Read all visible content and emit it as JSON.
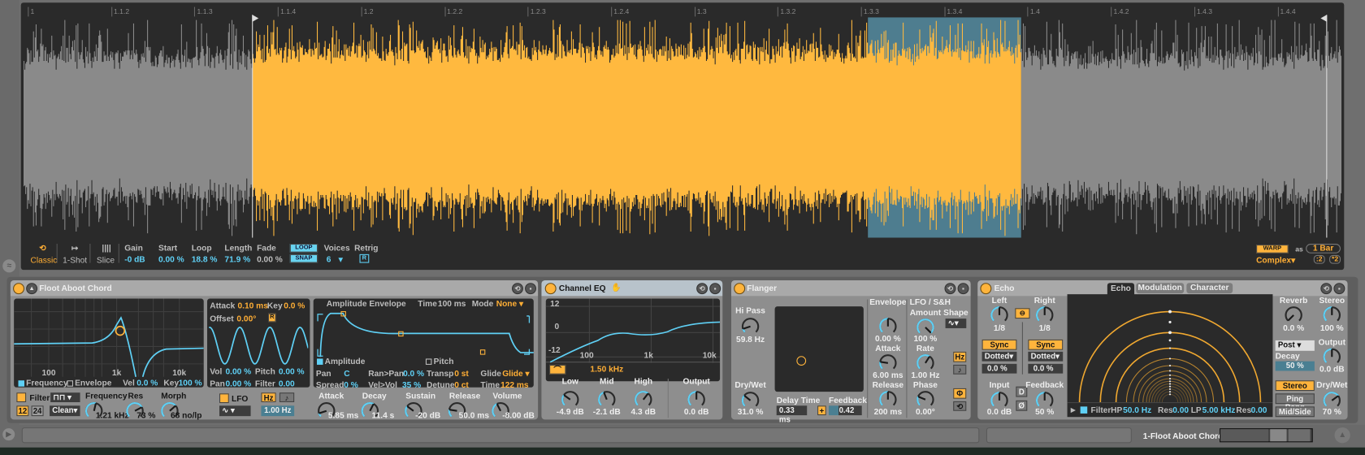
{
  "ruler": [
    "1",
    "1.1.2",
    "1.1.3",
    "1.1.4",
    "1.2",
    "1.2.2",
    "1.2.3",
    "1.2.4",
    "1.3",
    "1.3.2",
    "1.3.3",
    "1.3.4",
    "1.4",
    "1.4.2",
    "1.4.3",
    "1.4.4"
  ],
  "sample": {
    "modes": [
      {
        "label": "Classic",
        "icon": "loop-icon",
        "active": true
      },
      {
        "label": "1-Shot",
        "icon": "one-shot-icon"
      },
      {
        "label": "Slice",
        "icon": "slice-icon"
      }
    ],
    "params": [
      {
        "label": "Gain",
        "value": "-0 dB"
      },
      {
        "label": "Start",
        "value": "0.00 %"
      },
      {
        "label": "Loop",
        "value": "18.8 %"
      },
      {
        "label": "Length",
        "value": "71.9 %"
      },
      {
        "label": "Fade",
        "value": "0.00 %"
      }
    ],
    "loop_btn": "LOOP",
    "snap_btn": "SNAP",
    "voices_label": "Voices",
    "voices_value": "6",
    "retrig_label": "Retrig",
    "retrig_btn": "R",
    "warp_btn": "WARP",
    "as_label": "as",
    "warp_length": "1 Bar",
    "warp_mode": "Complex",
    "half_btn": ":2",
    "double_btn": "*2",
    "colors": {
      "waveform": "#8a8a8a",
      "selected": "#ffb93f",
      "loop_region": "#4e7d8f"
    }
  },
  "instrument": {
    "title": "Floot Aboot Chord",
    "filter_display": {
      "ticks": [
        "100",
        "1k",
        "10k"
      ],
      "frequency_tab": "Frequency",
      "envelope_tab": "Envelope",
      "vel_label": "Vel",
      "vel_value": "0.0 %",
      "key_label": "Key",
      "key_value": "100 %"
    },
    "filter": {
      "label": "Filter",
      "type": "⊓⊓",
      "slope_12": "12",
      "slope_24": "24",
      "circuit": "Clean",
      "frequency_label": "Frequency",
      "frequency_value": "1.21 kHz",
      "res_label": "Res",
      "res_value": "73 %",
      "morph_label": "Morph",
      "morph_value": "68 no/lp"
    },
    "lfo_display": {
      "attack_label": "Attack",
      "attack_value": "0.10 ms",
      "key_label": "Key",
      "key_value": "0.0 %",
      "offset_label": "Offset",
      "offset_value": "0.00°",
      "r_btn": "R",
      "vol_label": "Vol",
      "vol_value": "0.00 %",
      "pitch_label": "Pitch",
      "pitch_value": "0.00 %",
      "pan_label": "Pan",
      "pan_value": "0.00 %",
      "filter_label": "Filter",
      "filter_value": "0.00"
    },
    "lfo": {
      "label": "LFO",
      "shape": "∿",
      "hz_btn": "Hz",
      "note_btn": "♪",
      "rate_value": "1.00 Hz"
    },
    "envelope": {
      "title": "Amplitude Envelope",
      "time_label": "Time",
      "time_value": "100 ms",
      "mode_label": "Mode",
      "mode_value": "None",
      "amplitude_tab": "Amplitude",
      "pitch_tab": "Pitch",
      "pan_label": "Pan",
      "pan_value": "C",
      "ranpan_label": "Ran>Pan",
      "ranpan_value": "0.0 %",
      "transp_label": "Transp",
      "transp_value": "0 st",
      "glide_label": "Glide",
      "glide_value": "Glide",
      "spread_label": "Spread",
      "spread_value": "0 %",
      "velvol_label": "Vel>Vol",
      "velvol_value": "35 %",
      "detune_label": "Detune",
      "detune_value": "0 ct",
      "gtime_label": "Time",
      "gtime_value": "122 ms"
    },
    "amp": [
      {
        "label": "Attack",
        "value": "5.85 ms"
      },
      {
        "label": "Decay",
        "value": "11.4 s"
      },
      {
        "label": "Sustain",
        "value": "-20 dB"
      },
      {
        "label": "Release",
        "value": "50.0 ms"
      },
      {
        "label": "Volume",
        "value": "-8.00 dB"
      }
    ]
  },
  "eq": {
    "title": "Channel EQ",
    "ylabels": [
      "12",
      "0",
      "-12"
    ],
    "xlabels": [
      "100",
      "1k",
      "10k"
    ],
    "freq_value": "1.50 kHz",
    "knobs": [
      {
        "label": "Low",
        "value": "-4.9 dB"
      },
      {
        "label": "Mid",
        "value": "-2.1 dB"
      },
      {
        "label": "High",
        "value": "4.3 dB"
      },
      {
        "label": "Output",
        "value": "0.0 dB"
      }
    ]
  },
  "flanger": {
    "title": "Flanger",
    "hipass_label": "Hi Pass",
    "hipass_value": "59.8 Hz",
    "drywet_label": "Dry/Wet",
    "drywet_value": "31.0 %",
    "delay_label": "Delay Time",
    "delay_value": "0.33 ms",
    "plus_btn": "+",
    "feedback_label": "Feedback",
    "feedback_value": "0.42",
    "envelope_label": "Envelope",
    "envelope_value": "0.00 %",
    "attack_label": "Attack",
    "attack_value": "6.00 ms",
    "release_label": "Release",
    "release_value": "200 ms",
    "lfo_label": "LFO / S&H",
    "amount_label": "Amount",
    "amount_value": "100 %",
    "shape_label": "Shape",
    "shape_value": "∿",
    "rate_label": "Rate",
    "rate_value": "1.00 Hz",
    "hz_btn": "Hz",
    "note_btn": "♪",
    "phase_label": "Phase",
    "phase_value": "0.00°",
    "phi_btn": "Φ",
    "spin_btn": "⟲"
  },
  "echo": {
    "title": "Echo",
    "tabs": [
      "Echo",
      "Modulation",
      "Character"
    ],
    "left_label": "Left",
    "left_value": "1/8",
    "right_label": "Right",
    "right_value": "1/8",
    "sync": "Sync",
    "dotted": "Dotted",
    "left_offset": "0.0 %",
    "right_offset": "0.0 %",
    "input_label": "Input",
    "input_value": "0.0 dB",
    "d_btn": "D",
    "phase_btn": "Ø",
    "feedback_label": "Feedback",
    "feedback_value": "50 %",
    "filter_label": "Filter",
    "hp_label": "HP",
    "hp_value": "50.0 Hz",
    "res1_label": "Res",
    "res1_value": "0.00",
    "lp_label": "LP",
    "lp_value": "5.00 kHz",
    "res2_label": "Res",
    "res2_value": "0.00",
    "reverb_label": "Reverb",
    "reverb_value": "0.0 %",
    "stereo_label": "Stereo",
    "stereo_value": "100 %",
    "post": "Post",
    "decay_label": "Decay",
    "decay_value": "50 %",
    "output_label": "Output",
    "output_value": "0.0 dB",
    "modes": [
      "Stereo",
      "Ping Pong",
      "Mid/Side"
    ],
    "drywet_label": "Dry/Wet",
    "drywet_value": "70 %"
  },
  "footer": {
    "track_name": "1-Floot Aboot Chord"
  }
}
